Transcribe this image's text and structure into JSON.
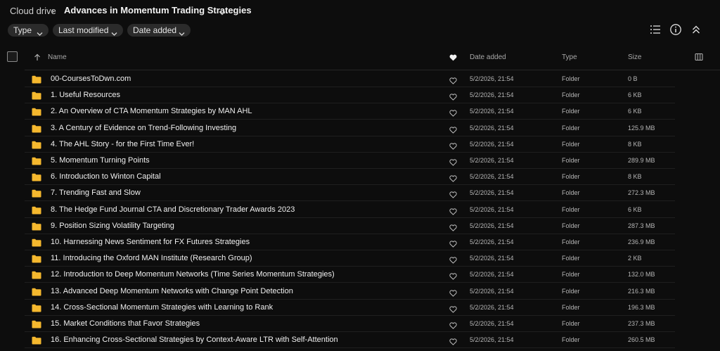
{
  "breadcrumb": {
    "root": "Cloud drive",
    "separator": "›",
    "current": "Advances in Momentum Trading Strategies"
  },
  "filters": [
    {
      "label": "Type"
    },
    {
      "label": "Last modified"
    },
    {
      "label": "Date added"
    }
  ],
  "toolbar": {
    "icons": [
      "list-view-icon",
      "info-icon",
      "collapse-icon"
    ]
  },
  "columns": {
    "name": "Name",
    "date_added": "Date added",
    "type": "Type",
    "size": "Size"
  },
  "colors": {
    "background": "#0d0d0d",
    "folder": "#f5b82e",
    "chip": "#2b2b2b"
  },
  "rows": [
    {
      "name": "00-CoursesToDwn.com",
      "date": "5/2/2026, 21:54",
      "type": "Folder",
      "size": "0 B"
    },
    {
      "name": "1. Useful Resources",
      "date": "5/2/2026, 21:54",
      "type": "Folder",
      "size": "6 KB"
    },
    {
      "name": "2. An Overview of CTA Momentum Strategies by MAN AHL",
      "date": "5/2/2026, 21:54",
      "type": "Folder",
      "size": "6 KB"
    },
    {
      "name": "3. A Century of Evidence on Trend-Following Investing",
      "date": "5/2/2026, 21:54",
      "type": "Folder",
      "size": "125.9 MB"
    },
    {
      "name": "4. The AHL Story - for the First Time Ever!",
      "date": "5/2/2026, 21:54",
      "type": "Folder",
      "size": "8 KB"
    },
    {
      "name": "5. Momentum Turning Points",
      "date": "5/2/2026, 21:54",
      "type": "Folder",
      "size": "289.9 MB"
    },
    {
      "name": "6. Introduction to Winton Capital",
      "date": "5/2/2026, 21:54",
      "type": "Folder",
      "size": "8 KB"
    },
    {
      "name": "7. Trending Fast and Slow",
      "date": "5/2/2026, 21:54",
      "type": "Folder",
      "size": "272.3 MB"
    },
    {
      "name": "8. The Hedge Fund Journal CTA and Discretionary Trader Awards 2023",
      "date": "5/2/2026, 21:54",
      "type": "Folder",
      "size": "6 KB"
    },
    {
      "name": "9. Position Sizing Volatility Targeting",
      "date": "5/2/2026, 21:54",
      "type": "Folder",
      "size": "287.3 MB"
    },
    {
      "name": "10. Harnessing News Sentiment for FX Futures Strategies",
      "date": "5/2/2026, 21:54",
      "type": "Folder",
      "size": "236.9 MB"
    },
    {
      "name": "11. Introducing the Oxford MAN Institute (Research Group)",
      "date": "5/2/2026, 21:54",
      "type": "Folder",
      "size": "2 KB"
    },
    {
      "name": "12. Introduction to Deep Momentum Networks (Time Series Momentum Strategies)",
      "date": "5/2/2026, 21:54",
      "type": "Folder",
      "size": "132.0 MB"
    },
    {
      "name": "13. Advanced Deep Momentum Networks with Change Point Detection",
      "date": "5/2/2026, 21:54",
      "type": "Folder",
      "size": "216.3 MB"
    },
    {
      "name": "14. Cross-Sectional Momentum Strategies with Learning to Rank",
      "date": "5/2/2026, 21:54",
      "type": "Folder",
      "size": "196.3 MB"
    },
    {
      "name": "15. Market Conditions that Favor Strategies",
      "date": "5/2/2026, 21:54",
      "type": "Folder",
      "size": "237.3 MB"
    },
    {
      "name": "16. Enhancing Cross-Sectional Strategies by Context-Aware LTR with Self-Attention",
      "date": "5/2/2026, 21:54",
      "type": "Folder",
      "size": "260.5 MB"
    }
  ]
}
